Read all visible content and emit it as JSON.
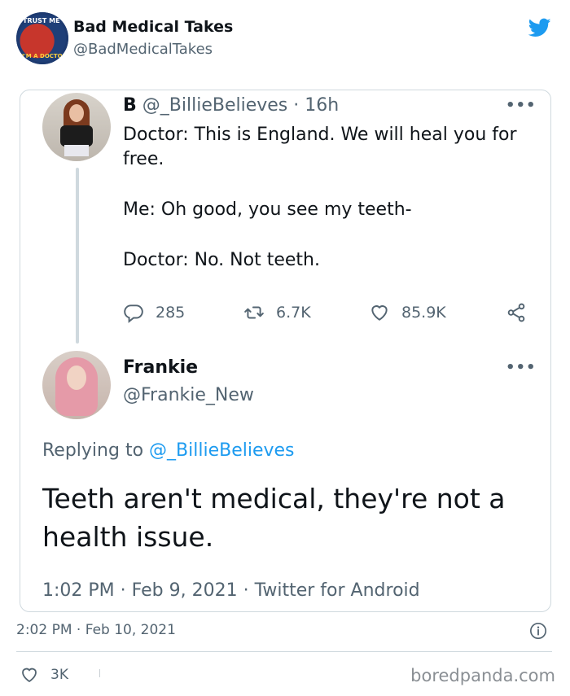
{
  "header": {
    "avatar_text_top": "TRUST ME",
    "avatar_text_bottom": "I'M A DOCTOR",
    "display_name": "Bad Medical Takes",
    "handle": "@BadMedicalTakes",
    "brand_color": "#1d9bf0",
    "icon": "twitter-bird-icon"
  },
  "quoted_tweet": {
    "display_name": "B",
    "handle": "@_BillieBelieves",
    "separator": "·",
    "time_ago": "16h",
    "more": "•••",
    "lines": [
      "Doctor: This is England. We will heal you for free.",
      "Me: Oh good, you see my teeth-",
      "Doctor: No. Not teeth."
    ],
    "actions": {
      "replies": "285",
      "retweets": "6.7K",
      "likes": "85.9K"
    }
  },
  "reply_tweet": {
    "display_name": "Frankie",
    "handle": "@Frankie_New",
    "more": "•••",
    "replying_prefix": "Replying to",
    "replying_to": "@_BillieBelieves",
    "text": "Teeth aren't medical, they're not a health issue.",
    "time": "1:02 PM",
    "date": "Feb 9, 2021",
    "source": "Twitter for Android",
    "sep": "·"
  },
  "outer_tweet": {
    "time": "2:02 PM",
    "sep": "·",
    "date": "Feb 10, 2021",
    "likes": "3K"
  },
  "watermark": "boredpanda.com"
}
